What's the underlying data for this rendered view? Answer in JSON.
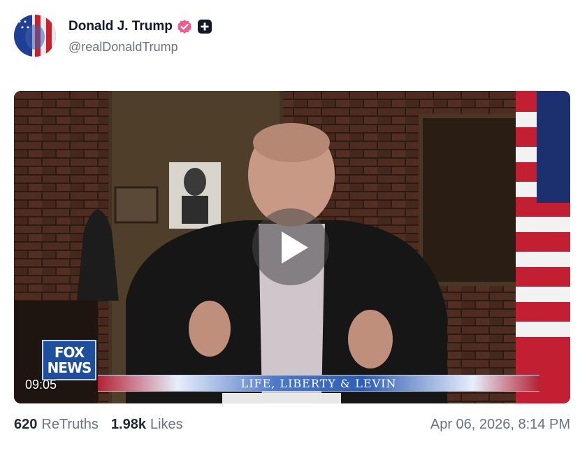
{
  "author": {
    "display_name": "Donald J. Trump",
    "handle": "@realDonaldTrump",
    "icons": [
      "avatar",
      "verified-badge-icon",
      "plus-icon"
    ],
    "verified_color": "#f25a8f"
  },
  "video": {
    "timestamp": "09:05",
    "network_logo": "FOX\nNEWS",
    "chyron": "LIFE, LIBERTY & LEVIN",
    "play_icon": "play-icon"
  },
  "stats": {
    "retruths_count": "620",
    "retruths_label": "ReTruths",
    "likes_count": "1.98k",
    "likes_label": "Likes",
    "date": "Apr 06, 2026, 8:14 PM"
  }
}
